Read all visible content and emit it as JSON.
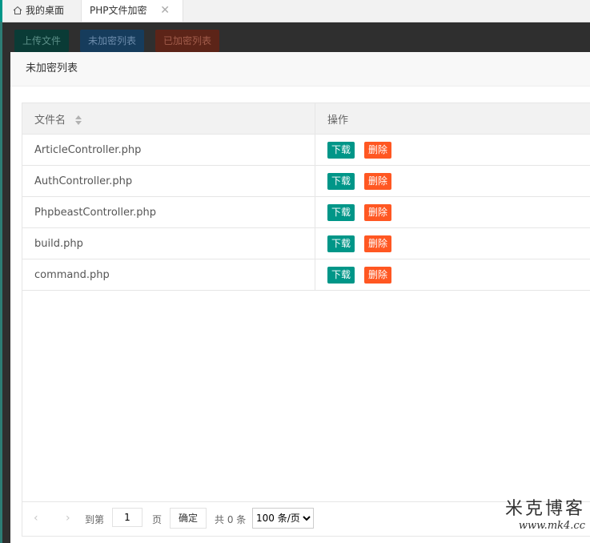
{
  "tabs": [
    {
      "label": "我的桌面",
      "icon": "home-icon"
    },
    {
      "label": "PHP文件加密",
      "active": true,
      "close_icon": "✕"
    }
  ],
  "toolbar": {
    "upload_label": "上传文件",
    "unencrypted_label": "未加密列表",
    "encrypted_label": "已加密列表"
  },
  "panel": {
    "title": "未加密列表",
    "columns": {
      "name": "文件名",
      "actions": "操作"
    },
    "rows": [
      {
        "name": "ArticleController.php"
      },
      {
        "name": "AuthController.php"
      },
      {
        "name": "PhpbeastController.php"
      },
      {
        "name": "build.php"
      },
      {
        "name": "command.php"
      }
    ],
    "download_label": "下载",
    "delete_label": "删除"
  },
  "pager": {
    "prev": "‹",
    "next": "›",
    "goto_label": "到第",
    "page_value": "1",
    "page_unit": "页",
    "confirm_label": "确定",
    "total_label": "共 0 条",
    "page_size_selected": "100 条/页"
  },
  "watermark": {
    "title": "米克博客",
    "url": "www.mk4.cc"
  },
  "colors": {
    "primary": "#009688",
    "danger": "#ff5722"
  }
}
